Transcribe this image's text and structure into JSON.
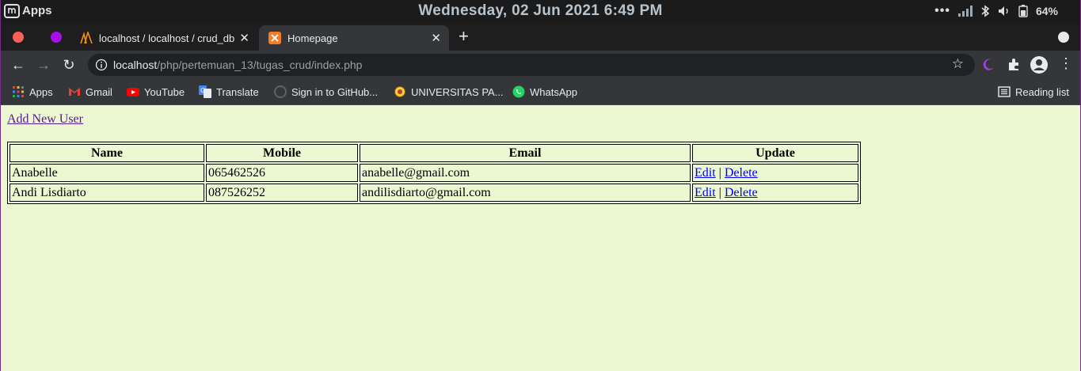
{
  "system_bar": {
    "apps_label": "Apps",
    "clock": "Wednesday, 02 Jun 2021  6:49 PM",
    "battery": "64%",
    "icons": [
      "menu-dots-icon",
      "signal-icon",
      "bluetooth-icon",
      "volume-icon",
      "battery-icon"
    ]
  },
  "tabs": [
    {
      "title": "localhost / localhost / crud_db",
      "icon": "phpmyadmin-icon",
      "active": false
    },
    {
      "title": "Homepage",
      "icon": "xampp-icon",
      "active": true
    }
  ],
  "toolbar": {
    "url_host": "localhost",
    "url_path": "/php/pertemuan_13/tugas_crud/index.php"
  },
  "bookmarks": [
    {
      "label": "Apps",
      "icon": "apps-grid-icon"
    },
    {
      "label": "Gmail",
      "icon": "gmail-icon"
    },
    {
      "label": "YouTube",
      "icon": "youtube-icon"
    },
    {
      "label": "Translate",
      "icon": "translate-icon"
    },
    {
      "label": "Sign in to GitHub...",
      "icon": "github-icon"
    },
    {
      "label": "UNIVERSITAS PA...",
      "icon": "university-icon"
    },
    {
      "label": "WhatsApp",
      "icon": "whatsapp-icon"
    }
  ],
  "reading_list": "Reading list",
  "page": {
    "add_link": "Add New User",
    "table": {
      "headers": [
        "Name",
        "Mobile",
        "Email",
        "Update"
      ],
      "rows": [
        {
          "name": "Anabelle",
          "mobile": "065462526",
          "email": "anabelle@gmail.com",
          "edit": "Edit",
          "sep": "|",
          "delete": "Delete"
        },
        {
          "name": "Andi Lisdiarto",
          "mobile": "087526252",
          "email": "andilisdiarto@gmail.com",
          "edit": "Edit",
          "sep": "|",
          "delete": "Delete"
        }
      ]
    }
  },
  "colors": {
    "page_bg": "#ebf8d2",
    "link": "#0000ee",
    "visited_link": "#551a8b",
    "browser_dark": "#35363a"
  }
}
